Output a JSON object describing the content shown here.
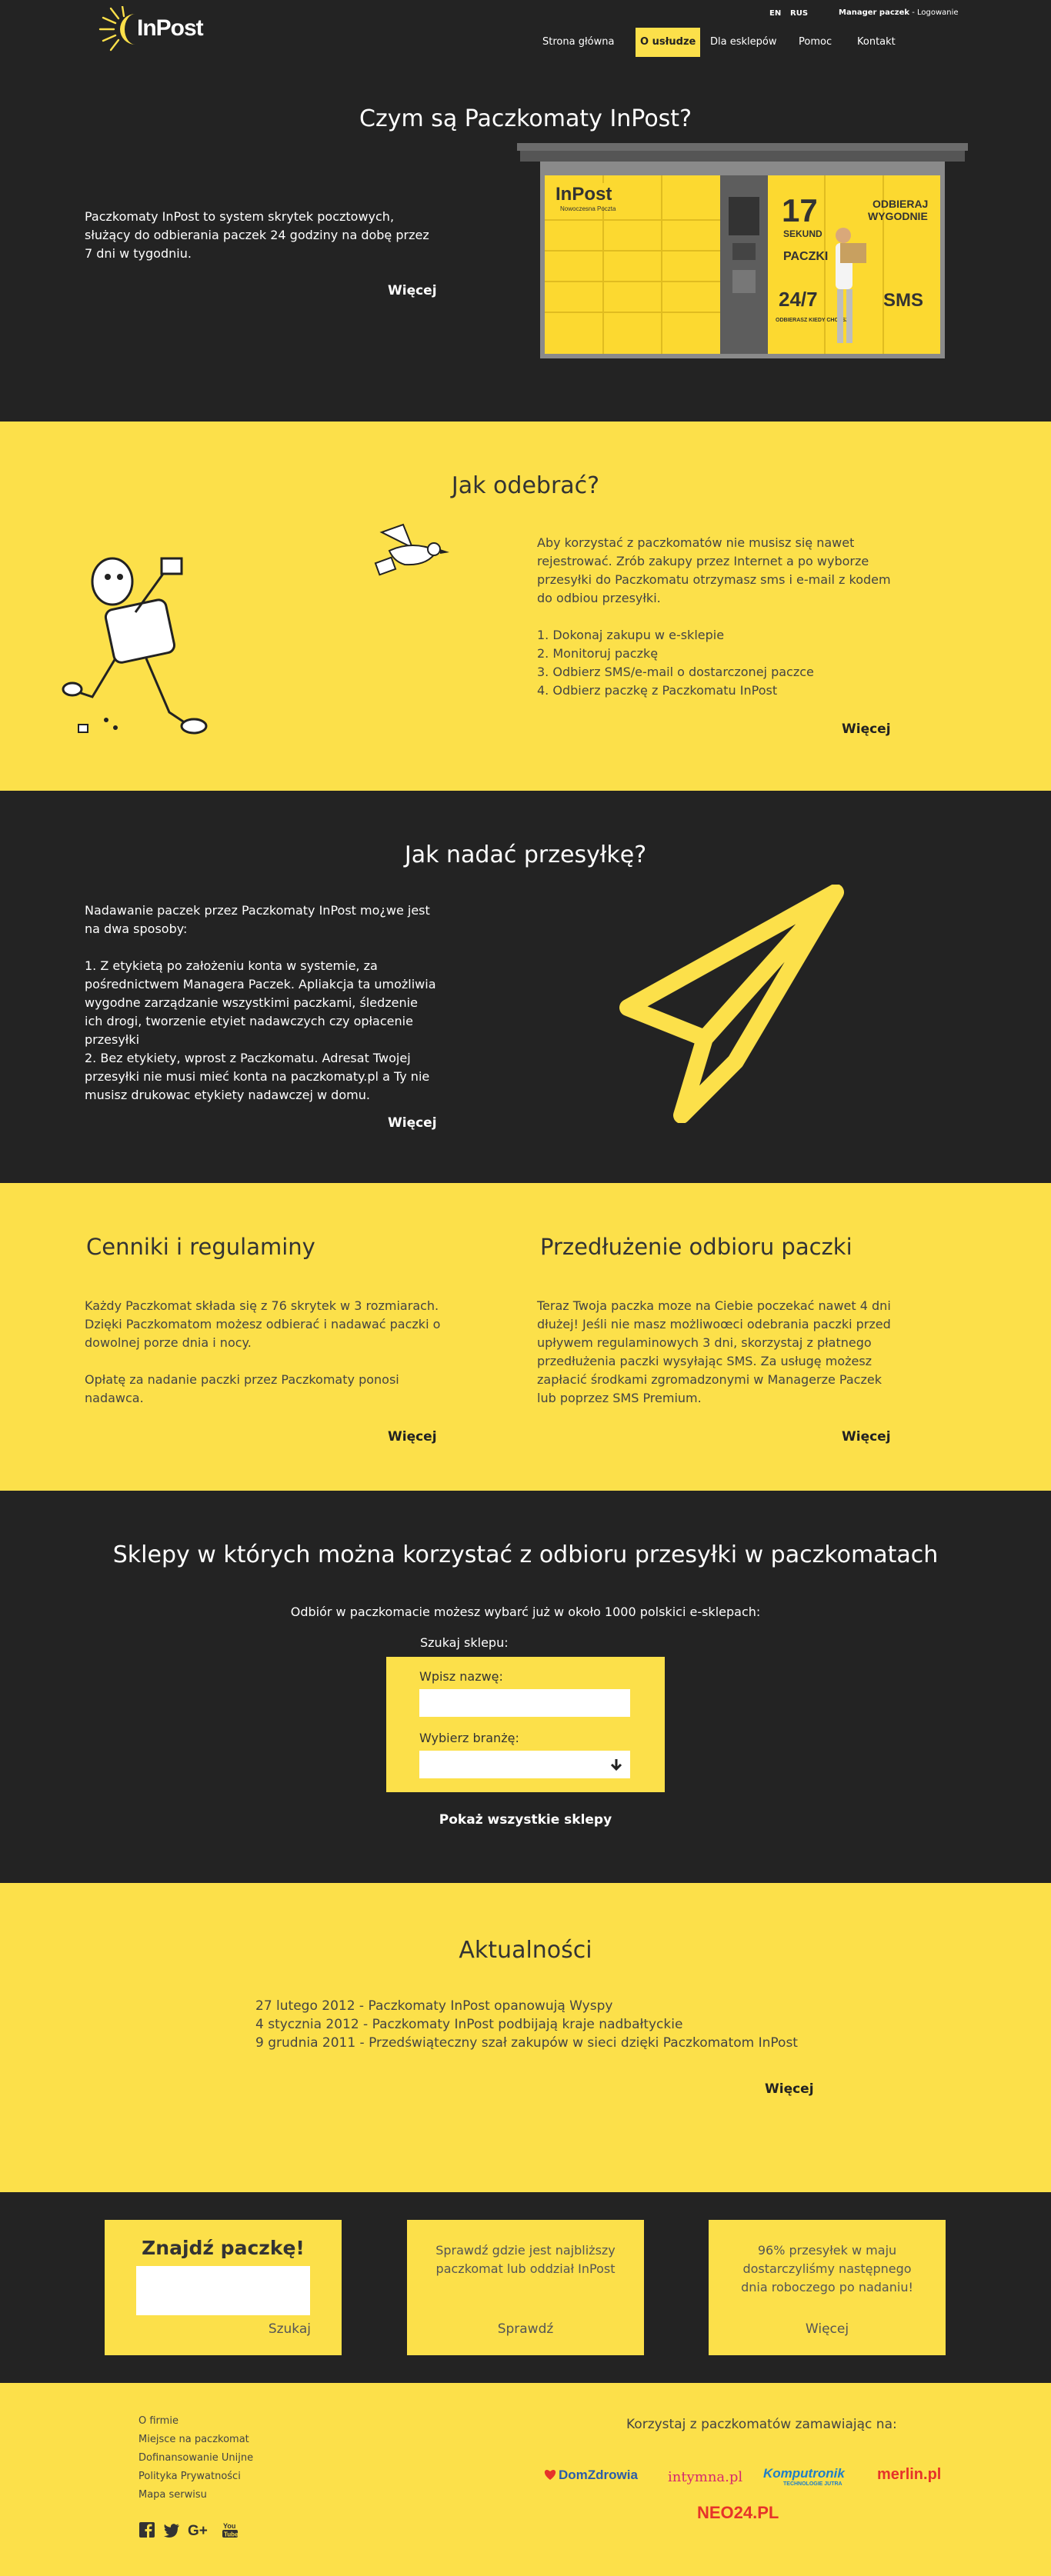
{
  "header": {
    "logo_text": "InPost",
    "lang_en": "EN",
    "lang_rus": "RUS",
    "manager_label": "Manager paczek",
    "login_label": " - Logowanie",
    "nav": [
      "Strona główna",
      "O usłudze",
      "Dla esklepów",
      "Pomoc",
      "Kontakt"
    ]
  },
  "hero": {
    "title": "Czym są Paczkomaty InPost?",
    "text": "Paczkomaty InPost to system skrytek pocztowych, służący do odbierania  paczek 24 godziny na dobę przez 7 dni w tygodniu.",
    "more": "Więcej",
    "locker": {
      "brand": "InPost",
      "brand_sub": "Nowoczesna Poczta",
      "big_number": "17",
      "seconds": "SEKUND",
      "parcels": "PACZKI",
      "odbieraj": "ODBIERAJ",
      "wygodnie": "WYGODNIE",
      "h247": "24/7",
      "odbierasz": "ODBIERASZ KIEDY CHCESZ",
      "sms": "SMS"
    }
  },
  "odebrac": {
    "title": "Jak odebrać?",
    "intro": "Aby korzystać z paczkomatów nie musisz się nawet rejestrować. Zrób zakupy przez Internet a po wyborze przesyłki do Paczkomatu otrzymasz sms i e-mail z kodem do odbiou przesyłki.",
    "steps": [
      "1. Dokonaj zakupu w e-sklepie",
      "2. Monitoruj paczkę",
      "3. Odbierz SMS/e-mail o dostarczonej paczce",
      "4. Odbierz paczkę z Paczkomatu InPost"
    ],
    "more": "Więcej"
  },
  "nadac": {
    "title": "Jak nadać przesyłkę?",
    "intro": "Nadawanie paczek przez Paczkomaty InPost mo¿we jest na dwa sposoby:",
    "way1": "1. Z etykietą po założeniu konta w systemie, za pośrednictwem Managera Paczek. Apliakcja ta umożliwia wygodne zarządzanie wszystkimi paczkami, śledzenie ich drogi, tworzenie etyiet nadawczych czy opłacenie przesyłki",
    "way2": "2. Bez etykiety, wprost z Paczkomatu. Adresat Twojej przesyłki nie musi mieć konta na paczkomaty.pl a Ty nie musisz drukowac etykiety nadawczej w domu.",
    "more": "Więcej"
  },
  "cenniki": {
    "title": "Cenniki i regulaminy",
    "p1": "Każdy Paczkomat składa się z 76 skrytek w 3 rozmiarach. Dzięki Paczkomatom możesz odbierać i nadawać paczki o dowolnej porze dnia i nocy.",
    "p2": "Opłatę za nadanie paczki przez Paczkomaty ponosi nadawca.",
    "more": "Więcej"
  },
  "przedluzenie": {
    "title": "Przedłużenie odbioru paczki",
    "text": "Teraz Twoja paczka moze na Ciebie poczekać nawet 4 dni dłużej! Jeśli nie masz możliwoœci odebrania paczki przed upływem regulaminowych 3 dni, skorzystaj z płatnego przedłużenia paczki wysyłając SMS. Za usługę możesz zapłacić środkami zgromadzonymi w Managerze Paczek lub poprzez SMS Premium.",
    "more": "Więcej"
  },
  "sklepy": {
    "title": "Sklepy w których można korzystać z odbioru przesyłki w paczkomatach",
    "subtitle": "Odbiór w paczkomacie możesz wybarć już w około 1000 polskici e-sklepach:",
    "search_label": "Szukaj sklepu:",
    "name_label": "Wpisz nazwę:",
    "category_label": "Wybierz branżę:",
    "show_all": "Pokaż wszystkie sklepy"
  },
  "aktualnosci": {
    "title": "Aktualności",
    "items": [
      "27 lutego 2012 - Paczkomaty InPost opanowują Wyspy",
      "4 stycznia 2012 - Paczkomaty InPost podbijają kraje nadbałtyckie",
      "9 grudnia 2011 - Przedświąteczny szał zakupów w sieci dzięki Paczkomatom InPost"
    ],
    "more": "Więcej"
  },
  "boxes": {
    "find": {
      "title": "Znajdź paczkę!",
      "button": "Szukaj"
    },
    "check": {
      "text": "Sprawdź gdzie jest najbliższy paczkomat lub oddział InPost",
      "button": "Sprawdź"
    },
    "delivered": {
      "text": "96% przesyłek w maju dostarczyliśmy następnego dnia roboczego po nadaniu!",
      "button": "Więcej"
    }
  },
  "footer": {
    "links": [
      "O firmie",
      "Miejsce na paczkomat",
      "Dofinansowanie Unijne",
      "Polityka Prywatności",
      "Mapa serwisu"
    ],
    "social": [
      "facebook-icon",
      "twitter-icon",
      "google-plus-icon",
      "youtube-icon"
    ],
    "partners_title": "Korzystaj z paczkomatów zamawiając na:",
    "partners": [
      "DomZdrowia",
      "intymna.pl",
      "Komputronik",
      "merlin.pl",
      "NEO24.PL"
    ],
    "komputronik_sub": "TECHNOLOGIE JUTRA"
  },
  "colors": {
    "yellow": "#fce04a",
    "dark": "#232323"
  }
}
